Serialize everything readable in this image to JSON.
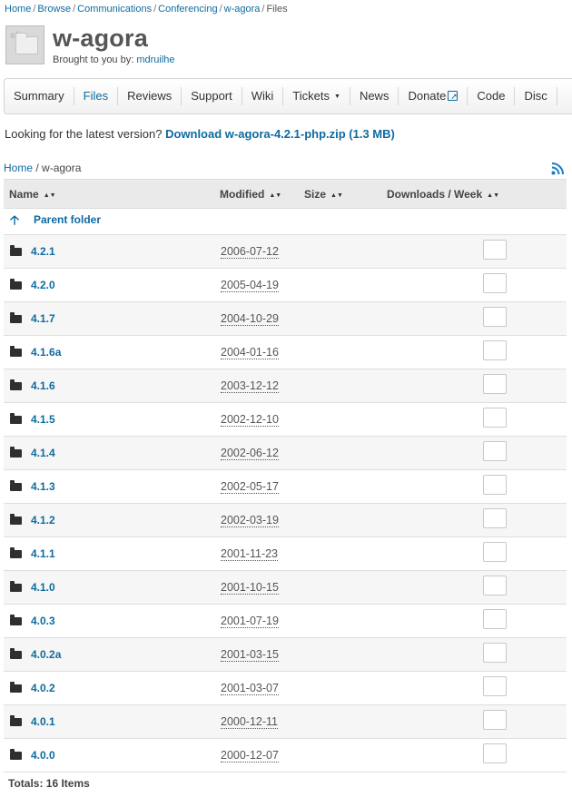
{
  "breadcrumbs": [
    "Home",
    "Browse",
    "Communications",
    "Conferencing",
    "w-agora",
    "Files"
  ],
  "project": {
    "title": "w-agora",
    "brought_by_label": "Brought to you by:",
    "author": "mdruilhe"
  },
  "tabs": [
    {
      "label": "Summary",
      "active": false
    },
    {
      "label": "Files",
      "active": true
    },
    {
      "label": "Reviews",
      "active": false
    },
    {
      "label": "Support",
      "active": false
    },
    {
      "label": "Wiki",
      "active": false
    },
    {
      "label": "Tickets",
      "active": false,
      "dropdown": true
    },
    {
      "label": "News",
      "active": false
    },
    {
      "label": "Donate",
      "active": false,
      "external": true
    },
    {
      "label": "Code",
      "active": false
    },
    {
      "label": "Disc",
      "active": false
    }
  ],
  "latest": {
    "prompt": "Looking for the latest version?",
    "link": "Download w-agora-4.2.1-php.zip (1.3 MB)"
  },
  "path": {
    "home": "Home",
    "current": "w-agora"
  },
  "table": {
    "headers": {
      "name": "Name",
      "modified": "Modified",
      "size": "Size",
      "downloads": "Downloads / Week"
    },
    "parent_label": "Parent folder",
    "rows": [
      {
        "name": "4.2.1",
        "modified": "2006-07-12",
        "size": "",
        "downloads": "0"
      },
      {
        "name": "4.2.0",
        "modified": "2005-04-19",
        "size": "",
        "downloads": "0"
      },
      {
        "name": "4.1.7",
        "modified": "2004-10-29",
        "size": "",
        "downloads": "0"
      },
      {
        "name": "4.1.6a",
        "modified": "2004-01-16",
        "size": "",
        "downloads": "0"
      },
      {
        "name": "4.1.6",
        "modified": "2003-12-12",
        "size": "",
        "downloads": "0"
      },
      {
        "name": "4.1.5",
        "modified": "2002-12-10",
        "size": "",
        "downloads": "0"
      },
      {
        "name": "4.1.4",
        "modified": "2002-06-12",
        "size": "",
        "downloads": "0"
      },
      {
        "name": "4.1.3",
        "modified": "2002-05-17",
        "size": "",
        "downloads": "0"
      },
      {
        "name": "4.1.2",
        "modified": "2002-03-19",
        "size": "",
        "downloads": "0"
      },
      {
        "name": "4.1.1",
        "modified": "2001-11-23",
        "size": "",
        "downloads": "0"
      },
      {
        "name": "4.1.0",
        "modified": "2001-10-15",
        "size": "",
        "downloads": "0"
      },
      {
        "name": "4.0.3",
        "modified": "2001-07-19",
        "size": "",
        "downloads": "0"
      },
      {
        "name": "4.0.2a",
        "modified": "2001-03-15",
        "size": "",
        "downloads": "0"
      },
      {
        "name": "4.0.2",
        "modified": "2001-03-07",
        "size": "",
        "downloads": "0"
      },
      {
        "name": "4.0.1",
        "modified": "2000-12-11",
        "size": "",
        "downloads": "0"
      },
      {
        "name": "4.0.0",
        "modified": "2000-12-07",
        "size": "",
        "downloads": "0"
      }
    ]
  },
  "totals": "Totals: 16 Items",
  "colors": {
    "link": "#0e6ba0",
    "header_bg": "#eaeaea",
    "rss": "#1a7bc4"
  }
}
